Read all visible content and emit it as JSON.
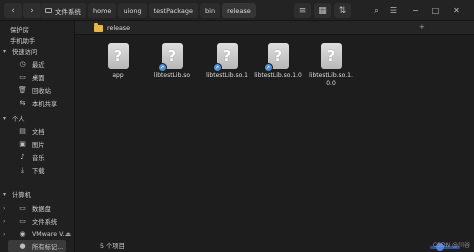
{
  "header": {
    "back_icon": "chevron-left-icon",
    "forward_icon": "chevron-right-icon",
    "breadcrumbs": [
      "文件系统",
      "home",
      "uiong",
      "testPackage",
      "bin",
      "release"
    ],
    "menu_icon": "hamburger-icon",
    "list_icon": "list-view-icon",
    "search_icon": "search-icon"
  },
  "sidebar": {
    "top_items": [
      "保护房",
      "手机助手"
    ],
    "sections": [
      {
        "label": "快速访问",
        "items": [
          "最近",
          "桌面",
          "回收站",
          "本机共享"
        ]
      },
      {
        "label": "个人",
        "items": [
          "文档",
          "图片",
          "音乐",
          "下载"
        ]
      },
      {
        "label": "计算机",
        "items": [
          "数据盘",
          "文件系统",
          "VMware V...",
          "所有标记..."
        ]
      }
    ]
  },
  "tab": {
    "label": "release"
  },
  "files": [
    {
      "name": "app",
      "symlink": false
    },
    {
      "name": "libtestLib.so",
      "symlink": true
    },
    {
      "name": "libtestLib.so.1",
      "symlink": true
    },
    {
      "name": "libtestLib.so.1.0",
      "symlink": true
    },
    {
      "name": "libtestLib.so.1.0.0",
      "symlink": false
    }
  ],
  "status": {
    "count_text": "5 个项目"
  },
  "watermark": "CSDN @川谷",
  "colors": {
    "folder": "#e8b64a",
    "link_badge": "#4a90d9",
    "zoom_slider": "#4f7fe0"
  }
}
